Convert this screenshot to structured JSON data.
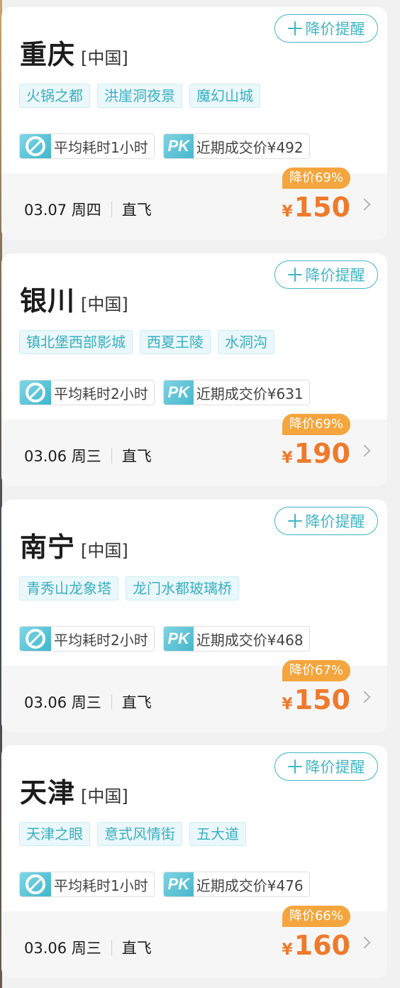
{
  "ui": {
    "remind_label": "降价提醒",
    "duration_prefix": "平均耗时",
    "pk_label": "PK",
    "recent_price_prefix": "近期成交价",
    "currency": "¥",
    "flight_type": "直飞",
    "accent_color": "#3fb6c6",
    "price_color": "#ef7a2c",
    "discount_color": "#f5a53d"
  },
  "cards": [
    {
      "city": "重庆",
      "country": "[中国]",
      "tags": [
        "火锅之都",
        "洪崖洞夜景",
        "魔幻山城"
      ],
      "duration": "平均耗时1小时",
      "recent_price": "近期成交价¥492",
      "date": "03.07 周四",
      "flight": "直飞",
      "discount": "降价69%",
      "price": "150"
    },
    {
      "city": "银川",
      "country": "[中国]",
      "tags": [
        "镇北堡西部影城",
        "西夏王陵",
        "水洞沟"
      ],
      "duration": "平均耗时2小时",
      "recent_price": "近期成交价¥631",
      "date": "03.06 周三",
      "flight": "直飞",
      "discount": "降价69%",
      "price": "190"
    },
    {
      "city": "南宁",
      "country": "[中国]",
      "tags": [
        "青秀山龙象塔",
        "龙门水都玻璃桥"
      ],
      "duration": "平均耗时2小时",
      "recent_price": "近期成交价¥468",
      "date": "03.06 周三",
      "flight": "直飞",
      "discount": "降价67%",
      "price": "150"
    },
    {
      "city": "天津",
      "country": "[中国]",
      "tags": [
        "天津之眼",
        "意式风情街",
        "五大道"
      ],
      "duration": "平均耗时1小时",
      "recent_price": "近期成交价¥476",
      "date": "03.06 周三",
      "flight": "直飞",
      "discount": "降价66%",
      "price": "160"
    }
  ]
}
